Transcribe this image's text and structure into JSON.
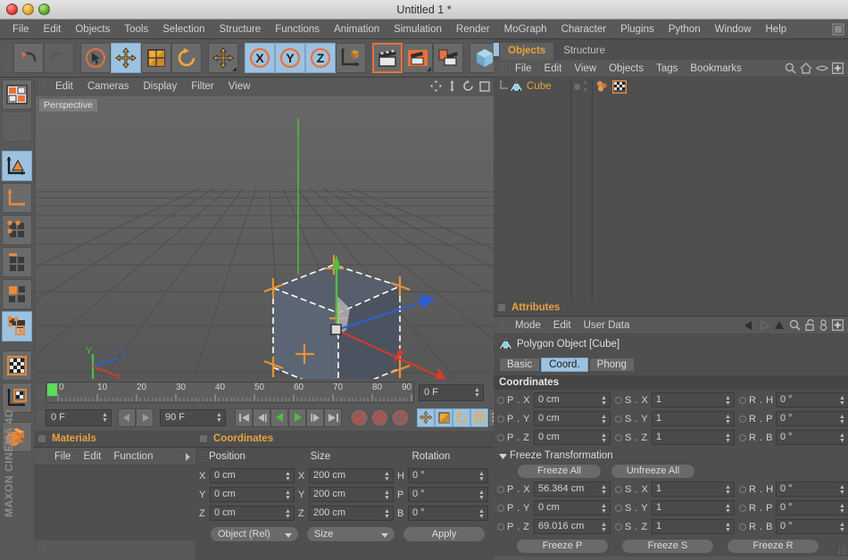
{
  "window": {
    "title": "Untitled 1 *",
    "traffic_lights": [
      "close",
      "minimize",
      "maximize"
    ]
  },
  "menubar": {
    "items": [
      "File",
      "Edit",
      "Objects",
      "Tools",
      "Selection",
      "Structure",
      "Functions",
      "Animation",
      "Simulation",
      "Render",
      "MoGraph",
      "Character",
      "Plugins",
      "Python",
      "Window",
      "Help"
    ]
  },
  "toolbar": {
    "buttons": [
      {
        "name": "undo",
        "icon": "undo-arrow-icon",
        "state": "normal"
      },
      {
        "name": "redo",
        "icon": "redo-arrow-icon",
        "state": "disabled"
      },
      {
        "name": "live-selection",
        "icon": "cursor-circle-icon",
        "state": "normal"
      },
      {
        "name": "move",
        "icon": "move-cross-icon",
        "state": "active"
      },
      {
        "name": "scale",
        "icon": "scale-box-icon",
        "state": "normal"
      },
      {
        "name": "rotate",
        "icon": "rotate-circle-icon",
        "state": "normal"
      },
      {
        "name": "move-tool-extra",
        "icon": "move-cross-icon",
        "state": "normal"
      },
      {
        "name": "axis-x",
        "icon": "x-axis-icon",
        "state": "active"
      },
      {
        "name": "axis-y",
        "icon": "y-axis-icon",
        "state": "active"
      },
      {
        "name": "axis-z",
        "icon": "z-axis-icon",
        "state": "active"
      },
      {
        "name": "world-object-coord",
        "icon": "world-axis-cube-icon",
        "state": "normal"
      },
      {
        "name": "render-view",
        "icon": "clapperboard-icon",
        "state": "selected"
      },
      {
        "name": "render-region",
        "icon": "clapperboard-region-icon",
        "state": "normal"
      },
      {
        "name": "render-settings",
        "icon": "clapperboard-settings-icon",
        "state": "normal"
      },
      {
        "name": "add-cube",
        "icon": "cube-icon",
        "state": "normal"
      }
    ]
  },
  "left_toolbar": {
    "buttons": [
      {
        "name": "layout-manager",
        "icon": "layout-grid-icon",
        "state": "normal"
      },
      {
        "name": "undo-view",
        "icon": "globe-view-icon",
        "state": "disabled"
      },
      {
        "name": "make-editable",
        "icon": "triangle-axis-icon",
        "state": "active"
      },
      {
        "name": "model-mode",
        "icon": "axis-corner-icon",
        "state": "normal"
      },
      {
        "name": "point-mode",
        "icon": "points-grid-icon",
        "state": "normal"
      },
      {
        "name": "edge-mode",
        "icon": "edge-grid-icon",
        "state": "normal"
      },
      {
        "name": "polygon-mode",
        "icon": "polygon-grid-icon",
        "state": "normal"
      },
      {
        "name": "texture-mode",
        "icon": "texture-polygon-icon",
        "state": "active"
      },
      {
        "name": "texture-axis",
        "icon": "checker-icon",
        "state": "normal"
      },
      {
        "name": "texture-axis-mode",
        "icon": "checker-axis-icon",
        "state": "normal"
      },
      {
        "name": "materials-shortcut",
        "icon": "material-spheres-icon",
        "state": "normal"
      }
    ],
    "branding": "MAXON CINEMA 4D"
  },
  "viewport": {
    "menu": [
      "Edit",
      "Cameras",
      "Display",
      "Filter",
      "View"
    ],
    "icons": [
      "pan-icon",
      "dolly-icon",
      "orbit-icon",
      "maximize-icon"
    ],
    "label": "Perspective",
    "axis_gizmo": {
      "y": "Y",
      "z": "Z",
      "x": "X"
    },
    "object": "Cube"
  },
  "timeline": {
    "ruler_labels": [
      "0",
      "10",
      "20",
      "30",
      "40",
      "50",
      "60",
      "70",
      "80",
      "90"
    ],
    "ruler_min": 0,
    "ruler_max": 90,
    "current_frame_field": "0 F",
    "start_frame": "0 F",
    "end_frame": "90 F",
    "playback_buttons": [
      "go-to-start",
      "frame-back",
      "play-reverse",
      "play-forward",
      "frame-forward",
      "go-to-end"
    ],
    "record_buttons": [
      "record-active-objects",
      "autokeying",
      "keyframe-selection"
    ],
    "key_toggles": [
      "position-key",
      "scale-key",
      "rotation-key",
      "parameter-key",
      "pla-key"
    ]
  },
  "objects_panel": {
    "tabs": [
      {
        "label": "Objects",
        "active": true
      },
      {
        "label": "Structure",
        "active": false
      }
    ],
    "menu": [
      "File",
      "Edit",
      "View",
      "Objects",
      "Tags",
      "Bookmarks"
    ],
    "menu_icons": [
      "search-icon",
      "home-icon",
      "eye-icon",
      "plus-box-icon"
    ],
    "rows": [
      {
        "name": "Cube",
        "icon": "polygon-object-icon",
        "visibility_dots": 2,
        "tags": [
          "material-tag",
          "checker-texture-tag"
        ]
      }
    ]
  },
  "attributes_panel": {
    "title": "Attributes",
    "menu": [
      "Mode",
      "Edit",
      "User Data"
    ],
    "menu_icons": [
      "back-arrow-icon",
      "forward-arrow-icon",
      "up-arrow-icon",
      "search-icon",
      "lock-icon",
      "pin-icon",
      "plus-box-icon"
    ],
    "object_header": "Polygon Object [Cube]",
    "object_icon": "polygon-object-icon",
    "tabs": [
      {
        "label": "Basic",
        "active": false
      },
      {
        "label": "Coord.",
        "active": true
      },
      {
        "label": "Phong",
        "active": false
      }
    ],
    "coordinates": {
      "section_title": "Coordinates",
      "rows": [
        {
          "p_label": "P . X",
          "p_value": "0 cm",
          "s_label": "S . X",
          "s_value": "1",
          "r_label": "R . H",
          "r_value": "0 °"
        },
        {
          "p_label": "P . Y",
          "p_value": "0 cm",
          "s_label": "S . Y",
          "s_value": "1",
          "r_label": "R . P",
          "r_value": "0 °"
        },
        {
          "p_label": "P . Z",
          "p_value": "0 cm",
          "s_label": "S . Z",
          "s_value": "1",
          "r_label": "R . B",
          "r_value": "0 °"
        }
      ]
    },
    "freeze": {
      "section_title": "Freeze Transformation",
      "freeze_all": "Freeze All",
      "unfreeze_all": "Unfreeze All",
      "rows": [
        {
          "p_label": "P . X",
          "p_value": "56.364 cm",
          "s_label": "S . X",
          "s_value": "1",
          "r_label": "R . H",
          "r_value": "0 °"
        },
        {
          "p_label": "P . Y",
          "p_value": "0 cm",
          "s_label": "S . Y",
          "s_value": "1",
          "r_label": "R . P",
          "r_value": "0 °"
        },
        {
          "p_label": "P . Z",
          "p_value": "69.016 cm",
          "s_label": "S . Z",
          "s_value": "1",
          "r_label": "R . B",
          "r_value": "0 °"
        }
      ],
      "freeze_p": "Freeze P",
      "freeze_s": "Freeze S",
      "freeze_r": "Freeze R"
    }
  },
  "materials_panel": {
    "title": "Materials",
    "menu": [
      "File",
      "Edit",
      "Function"
    ],
    "overflow_icon": "chevron-right-icon"
  },
  "coordinates_panel": {
    "title": "Coordinates",
    "headers": [
      "Position",
      "Size",
      "Rotation"
    ],
    "rows": [
      {
        "axis": "X",
        "position": "0 cm",
        "size_axis": "X",
        "size": "200 cm",
        "rot_axis": "H",
        "rotation": "0 °"
      },
      {
        "axis": "Y",
        "position": "0 cm",
        "size_axis": "Y",
        "size": "200 cm",
        "rot_axis": "P",
        "rotation": "0 °"
      },
      {
        "axis": "Z",
        "position": "0 cm",
        "size_axis": "Z",
        "size": "200 cm",
        "rot_axis": "B",
        "rotation": "0 °"
      }
    ],
    "mode_select": "Object (Rel)",
    "size_select": "Size",
    "apply_button": "Apply"
  },
  "colors": {
    "accent_orange": "#e8a33d",
    "active_blue": "#9dc2e0",
    "selection_orange": "#e8713a",
    "panel_bg": "#585858",
    "body_bg": "#4f4f4f",
    "axis_x": "#d63b2a",
    "axis_y": "#4fbf3f",
    "axis_z": "#3a6fd8"
  }
}
